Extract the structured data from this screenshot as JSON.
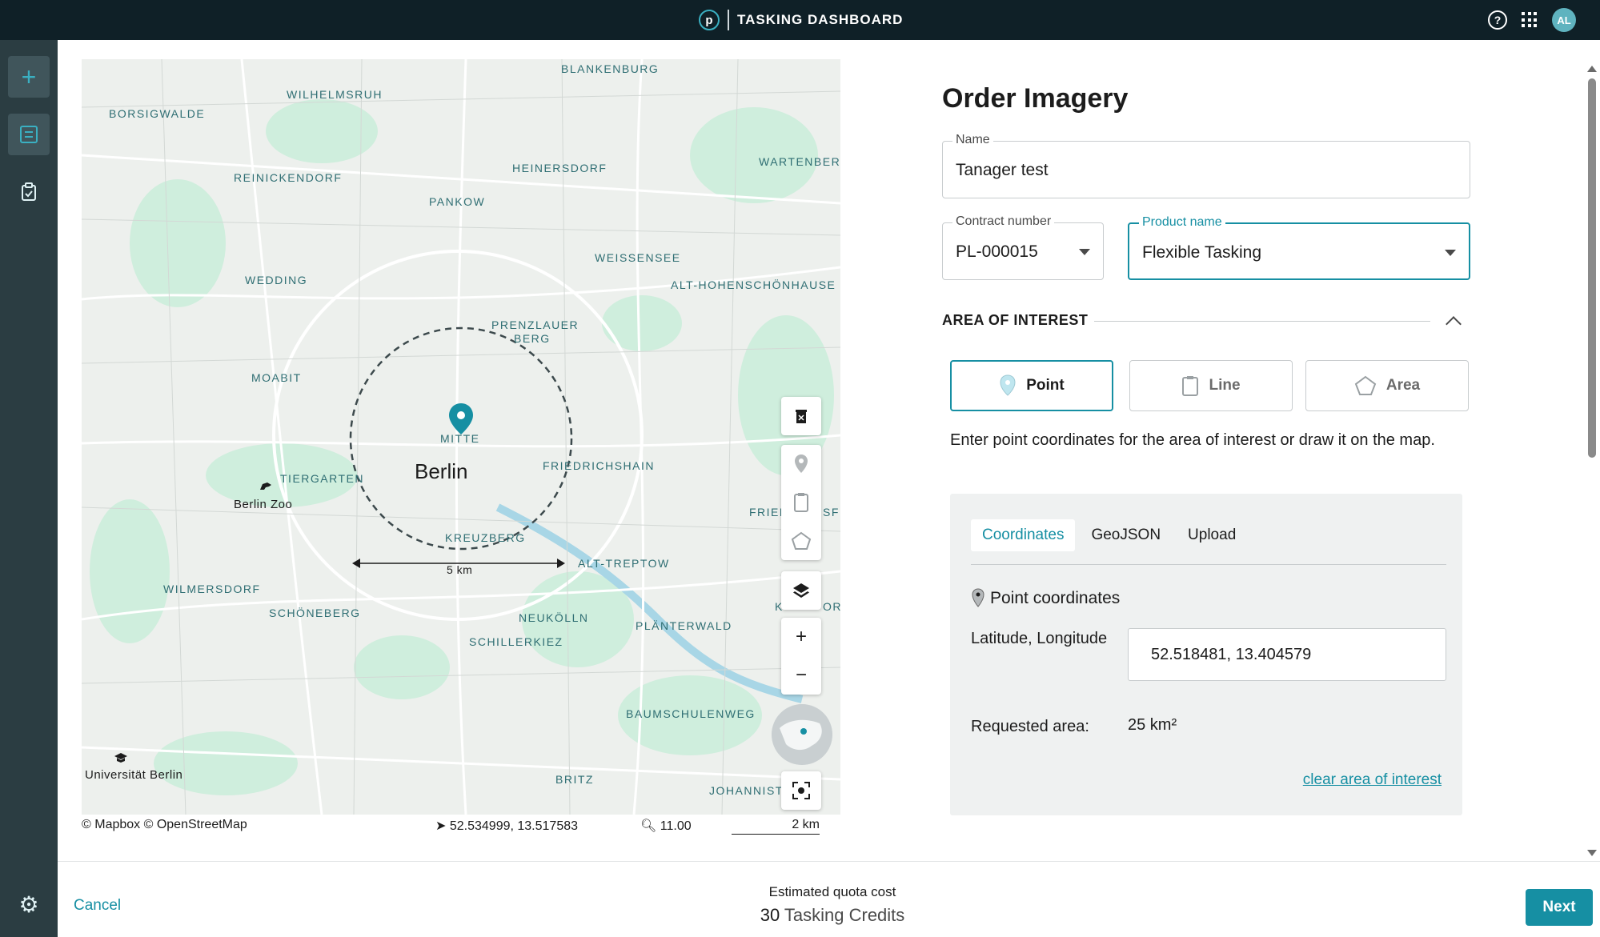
{
  "header": {
    "logo_letter": "p",
    "title": "TASKING DASHBOARD",
    "help_glyph": "?",
    "avatar_initials": "AL"
  },
  "rail": {
    "add_glyph": "+",
    "settings_glyph": "⚙"
  },
  "map": {
    "city_label": "Berlin",
    "places": [
      {
        "key": "blankenburg",
        "label": "BLANKENBURG"
      },
      {
        "key": "wilhelmsruh",
        "label": "WILHELMSRUH"
      },
      {
        "key": "borsigwalde",
        "label": "BORSIGWALDE"
      },
      {
        "key": "heinersdorf",
        "label": "HEINERSDORF"
      },
      {
        "key": "wartenberg",
        "label": "WARTENBERG"
      },
      {
        "key": "reinickendorf",
        "label": "REINICKENDORF"
      },
      {
        "key": "pankow",
        "label": "PANKOW"
      },
      {
        "key": "weissensee",
        "label": "WEISSENSEE"
      },
      {
        "key": "wedding",
        "label": "WEDDING"
      },
      {
        "key": "alt_hohenschoenhausen",
        "label": "ALT-HOHENSCHÖNHAUSE"
      },
      {
        "key": "prenzlauer",
        "label": "PRENZLAUER"
      },
      {
        "key": "berg",
        "label": "BERG"
      },
      {
        "key": "moabit",
        "label": "MOABIT"
      },
      {
        "key": "mitte",
        "label": "MITTE"
      },
      {
        "key": "friedrichshain",
        "label": "FRIEDRICHSHAIN"
      },
      {
        "key": "tiergarten",
        "label": "TIERGARTEN"
      },
      {
        "key": "fried",
        "label": "FRIED"
      },
      {
        "key": "sfe",
        "label": "SFE"
      },
      {
        "key": "kreuzberg",
        "label": "KREUZBERG"
      },
      {
        "key": "alt_treptow",
        "label": "ALT-TREPTOW"
      },
      {
        "key": "wilmersdorf",
        "label": "WILMERSDORF"
      },
      {
        "key": "k",
        "label": "K"
      },
      {
        "key": "or",
        "label": "OR"
      },
      {
        "key": "schoeneberg",
        "label": "SCHÖNEBERG"
      },
      {
        "key": "neukoelln",
        "label": "NEUKÖLLN"
      },
      {
        "key": "plaenterwald",
        "label": "PLÄNTERWALD"
      },
      {
        "key": "schillerkiez",
        "label": "SCHILLERKIEZ"
      },
      {
        "key": "baumschulenweg",
        "label": "BAUMSCHULENWEG"
      },
      {
        "key": "britz",
        "label": "BRITZ"
      },
      {
        "key": "johannist",
        "label": "JOHANNIST"
      }
    ],
    "poi_zoo": "Berlin Zoo",
    "poi_uni": "Universität Berlin",
    "radius_label": "5 km",
    "attribution": "© Mapbox © OpenStreetMap",
    "cursor_coords": "52.534999, 13.517583",
    "zoom": "11.00",
    "scale": "2 km"
  },
  "form": {
    "title": "Order Imagery",
    "name_label": "Name",
    "name_value": "Tanager test",
    "contract_label": "Contract number",
    "contract_value": "PL-000015",
    "product_label": "Product name",
    "product_value": "Flexible Tasking",
    "aoi_title": "AREA OF INTEREST",
    "geom_point": "Point",
    "geom_line": "Line",
    "geom_area": "Area",
    "hint": "Enter point coordinates for the area of interest or draw it on the map.",
    "tabs": {
      "coordinates": "Coordinates",
      "geojson": "GeoJSON",
      "upload": "Upload"
    },
    "point_coords_label": "Point coordinates",
    "latlon_label": "Latitude, Longitude",
    "latlon_value": "52.518481, 13.404579",
    "requested_label": "Requested area:",
    "requested_value": "25 km²",
    "clear_link": "clear area of interest"
  },
  "footer": {
    "cancel": "Cancel",
    "quota_label": "Estimated quota cost",
    "quota_number": "30",
    "quota_unit": "Tasking Credits",
    "next": "Next"
  },
  "colors": {
    "accent": "#168fa3",
    "topbar": "#0f2027",
    "rail": "#2b3d42",
    "panel": "#eff1f1"
  }
}
